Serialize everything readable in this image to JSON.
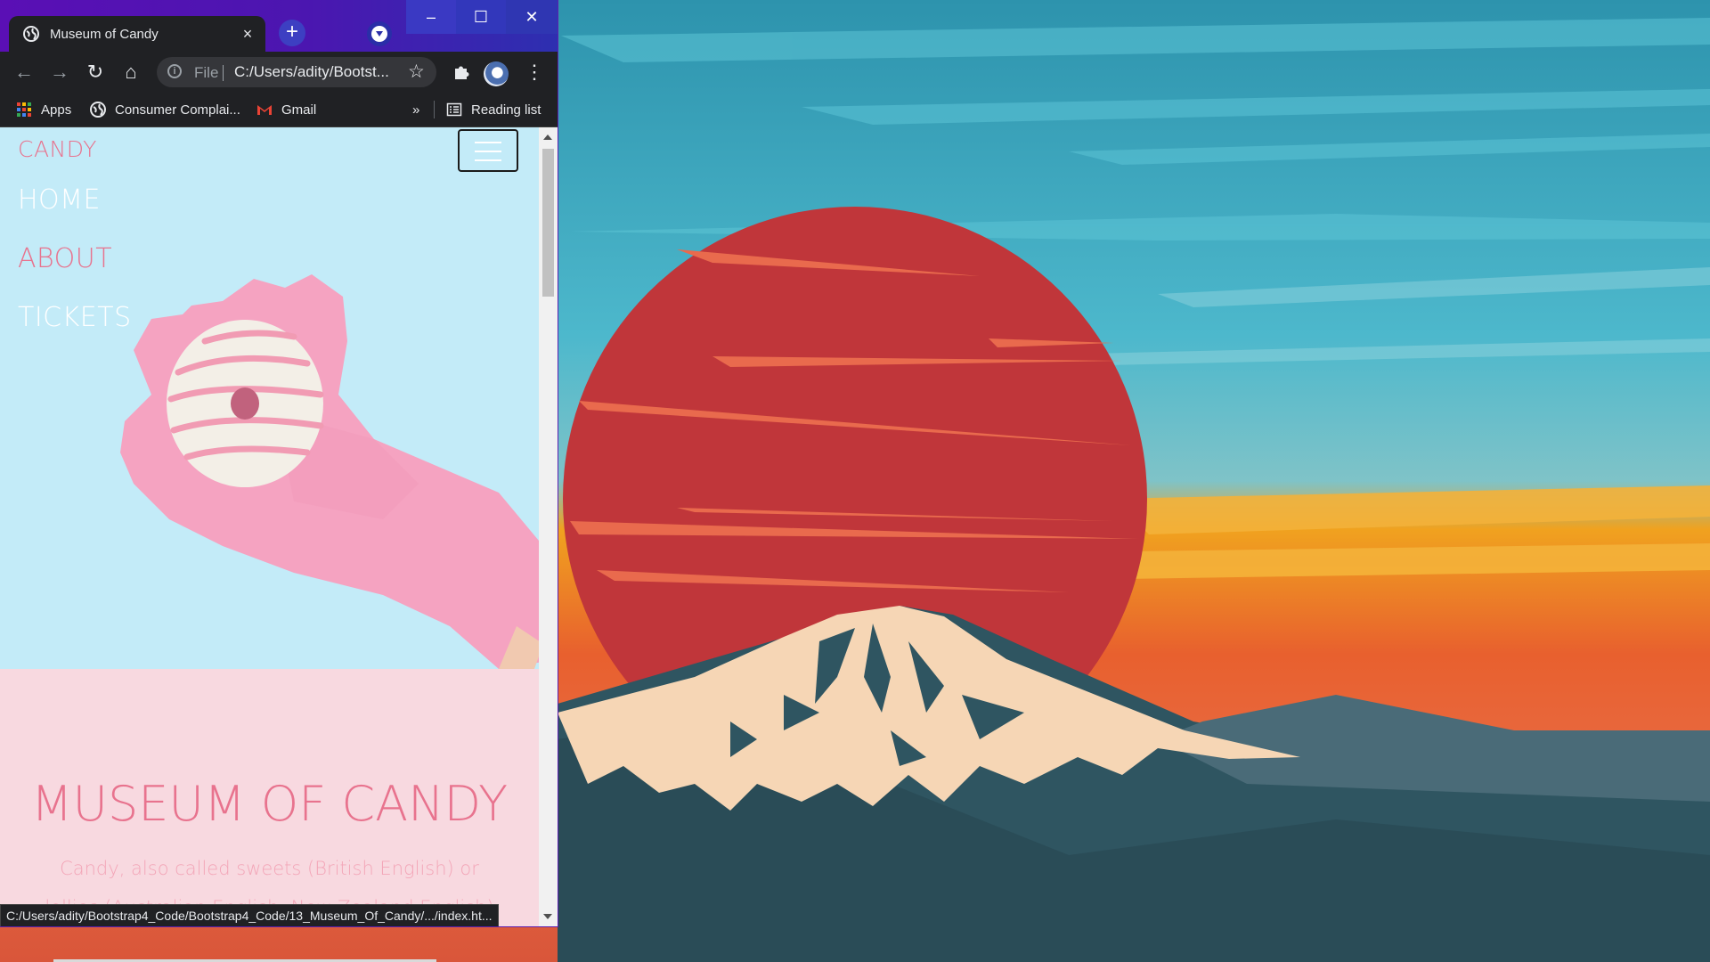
{
  "browser": {
    "tab": {
      "title": "Museum of Candy",
      "close_icon": "×"
    },
    "new_tab_label": "+",
    "window_controls": {
      "minimize": "–",
      "maximize": "☐",
      "close": "✕"
    },
    "toolbar": {
      "back_icon": "←",
      "forward_icon": "→",
      "reload_icon": "↻",
      "home_icon": "⌂",
      "scheme_label": "File",
      "url": "C:/Users/adity/Bootst...",
      "bookmark_star_icon": "☆",
      "extensions_icon": "puzzle-icon",
      "menu_icon": "⋮"
    },
    "bookmarks": {
      "apps_label": "Apps",
      "consumer_label": "Consumer Complai...",
      "gmail_label": "Gmail",
      "overflow_label": "»",
      "reading_list_label": "Reading list"
    },
    "status_url": "C:/Users/adity/Bootstrap4_Code/Bootstrap4_Code/13_Museum_Of_Candy/.../index.ht..."
  },
  "page": {
    "brand": "CANDY",
    "nav": [
      {
        "label": "HOME",
        "color": "#ffffff"
      },
      {
        "label": "ABOUT",
        "color": "#e8738e"
      },
      {
        "label": "TICKETS",
        "color": "#ffffff"
      }
    ],
    "title": "MUSEUM OF CANDY",
    "description": "Candy, also called sweets (British English) or lollies (Australian English, New Zealand English)",
    "colors": {
      "hero_bg": "#c3ebf8",
      "section_bg": "#f8d9e0",
      "accent": "#e8738e"
    }
  },
  "wallpaper": {
    "description_colors": {
      "sky": "#3aa6bd",
      "sun": "#c0363a",
      "mountain": "#2f5561",
      "snow": "#f6d6b5"
    }
  }
}
